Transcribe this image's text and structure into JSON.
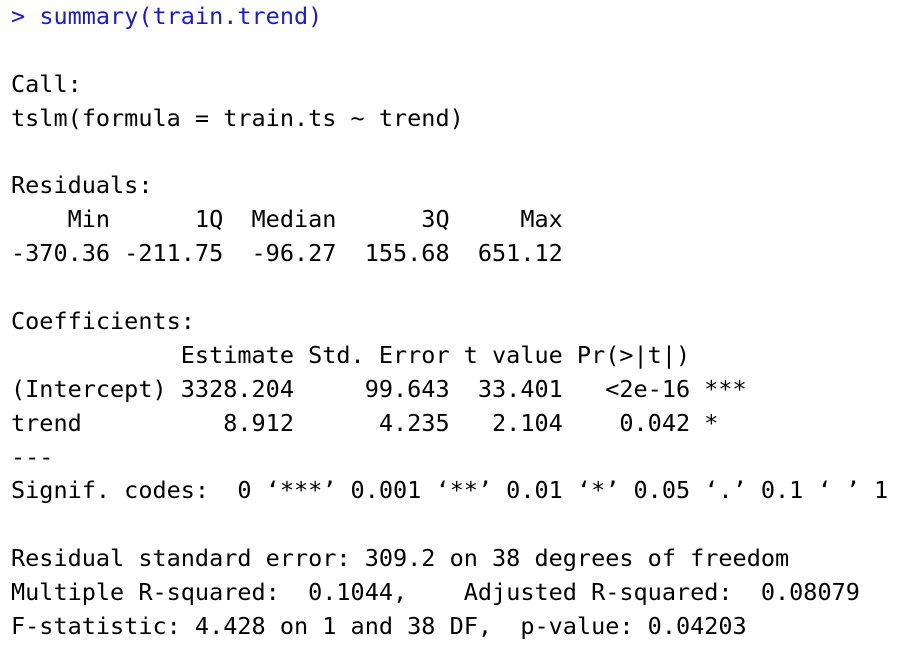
{
  "console": {
    "command": {
      "prompt": ">",
      "text": "summary(train.trend)"
    },
    "call_header": "Call:",
    "call_formula": "tslm(formula = train.ts ~ trend)",
    "residuals_header": "Residuals:",
    "residuals_labels": "    Min      1Q  Median      3Q     Max ",
    "residuals_values": "-370.36 -211.75  -96.27  155.68  651.12 ",
    "coefficients_header": "Coefficients:",
    "coef_col_headers": "            Estimate Std. Error t value Pr(>|t|)    ",
    "coef_rows": [
      "(Intercept) 3328.204     99.643  33.401   <2e-16 ***",
      "trend          8.912      4.235   2.104    0.042 *  "
    ],
    "separator": "---",
    "signif_codes": "Signif. codes:  0 ‘***’ 0.001 ‘**’ 0.01 ‘*’ 0.05 ‘.’ 0.1 ‘ ’ 1",
    "residual_std_error": "Residual standard error: 309.2 on 38 degrees of freedom",
    "r_squared": "Multiple R-squared:  0.1044,\tAdjusted R-squared:  0.08079 ",
    "f_statistic": "F-statistic: 4.428 on 1 and 38 DF,  p-value: 0.04203"
  },
  "colors": {
    "command_text": "#1a1ad0",
    "output_text": "#000000",
    "background": "#ffffff"
  }
}
